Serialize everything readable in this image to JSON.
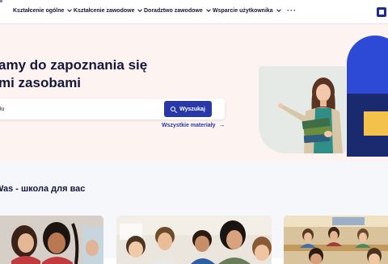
{
  "nav": {
    "items": [
      {
        "label": "Kształcenie ogólne"
      },
      {
        "label": "Kształcenie zawodowe"
      },
      {
        "label": "Doradztwo zawodowe"
      },
      {
        "label": "Wsparcie użytkownika"
      }
    ],
    "more": "···",
    "account_icon": "user-icon"
  },
  "hero": {
    "title_line1": "amy do zapoznania się",
    "title_line2": "mi zasobami",
    "search": {
      "value": "łu",
      "button_label": "Wyszukaj"
    },
    "all_materials": "Wszystkie materiały",
    "colors": {
      "background": "#fdf3f1",
      "accent": "#2838a8",
      "arch": "#2c4ad6",
      "yellow": "#f2c24a",
      "navy": "#1a2a6e"
    }
  },
  "section": {
    "title": "Was - школа для вас",
    "cards": [
      {
        "image": "girls-smiling-photo"
      },
      {
        "image": "children-in-classroom-photo"
      },
      {
        "image": "classroom-students-photo"
      }
    ]
  }
}
